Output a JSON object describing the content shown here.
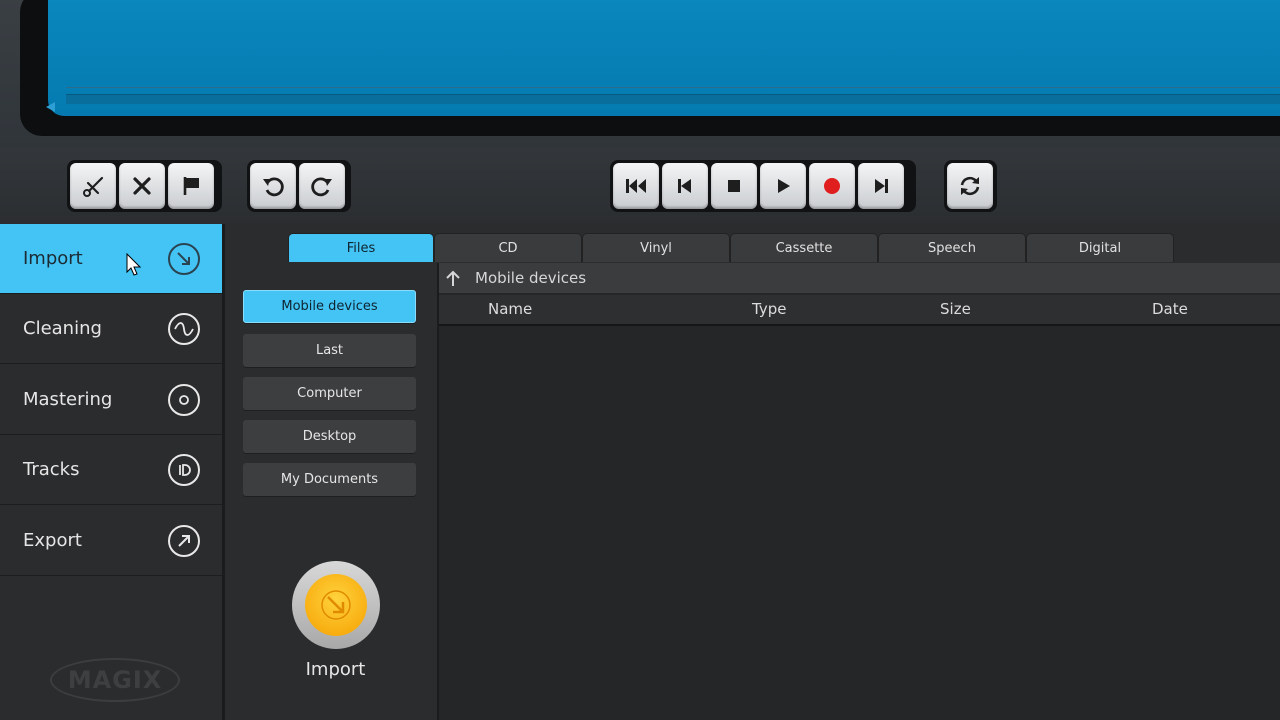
{
  "toolbar": {
    "edit_group": [
      {
        "name": "cut-button",
        "icon": "scissors-icon"
      },
      {
        "name": "delete-button",
        "icon": "x-icon"
      },
      {
        "name": "marker-button",
        "icon": "flag-icon"
      }
    ],
    "history_group": [
      {
        "name": "undo-button",
        "icon": "undo-icon"
      },
      {
        "name": "redo-button",
        "icon": "redo-icon"
      }
    ],
    "transport_group": [
      {
        "name": "rewind-start-button",
        "icon": "skip-back-icon"
      },
      {
        "name": "previous-button",
        "icon": "step-back-icon"
      },
      {
        "name": "stop-button",
        "icon": "stop-icon"
      },
      {
        "name": "play-button",
        "icon": "play-icon"
      },
      {
        "name": "record-button",
        "icon": "record-icon",
        "color": "#e01e1e"
      },
      {
        "name": "next-button",
        "icon": "step-forward-icon"
      }
    ],
    "loop_group": [
      {
        "name": "loop-button",
        "icon": "loop-icon"
      }
    ]
  },
  "sidebar": {
    "items": [
      {
        "label": "Import",
        "icon": "import-icon",
        "active": true
      },
      {
        "label": "Cleaning",
        "icon": "wave-icon",
        "active": false
      },
      {
        "label": "Mastering",
        "icon": "disc-icon",
        "active": false
      },
      {
        "label": "Tracks",
        "icon": "id-icon",
        "active": false
      },
      {
        "label": "Export",
        "icon": "export-icon",
        "active": false
      }
    ],
    "logo": "MAGIX"
  },
  "tabs": [
    "Files",
    "CD",
    "Vinyl",
    "Cassette",
    "Speech",
    "Digital"
  ],
  "active_tab": "Files",
  "locations": {
    "items": [
      "Mobile devices",
      "Last",
      "Computer",
      "Desktop",
      "My Documents"
    ],
    "active": "Mobile devices",
    "import_label": "Import"
  },
  "browser": {
    "path": "Mobile devices",
    "columns": {
      "name": "Name",
      "type": "Type",
      "size": "Size",
      "date": "Date"
    },
    "rows": []
  },
  "colors": {
    "accent": "#43c4f5",
    "display": "#0884ba",
    "record": "#e01e1e",
    "import_button": "#f5a800"
  }
}
